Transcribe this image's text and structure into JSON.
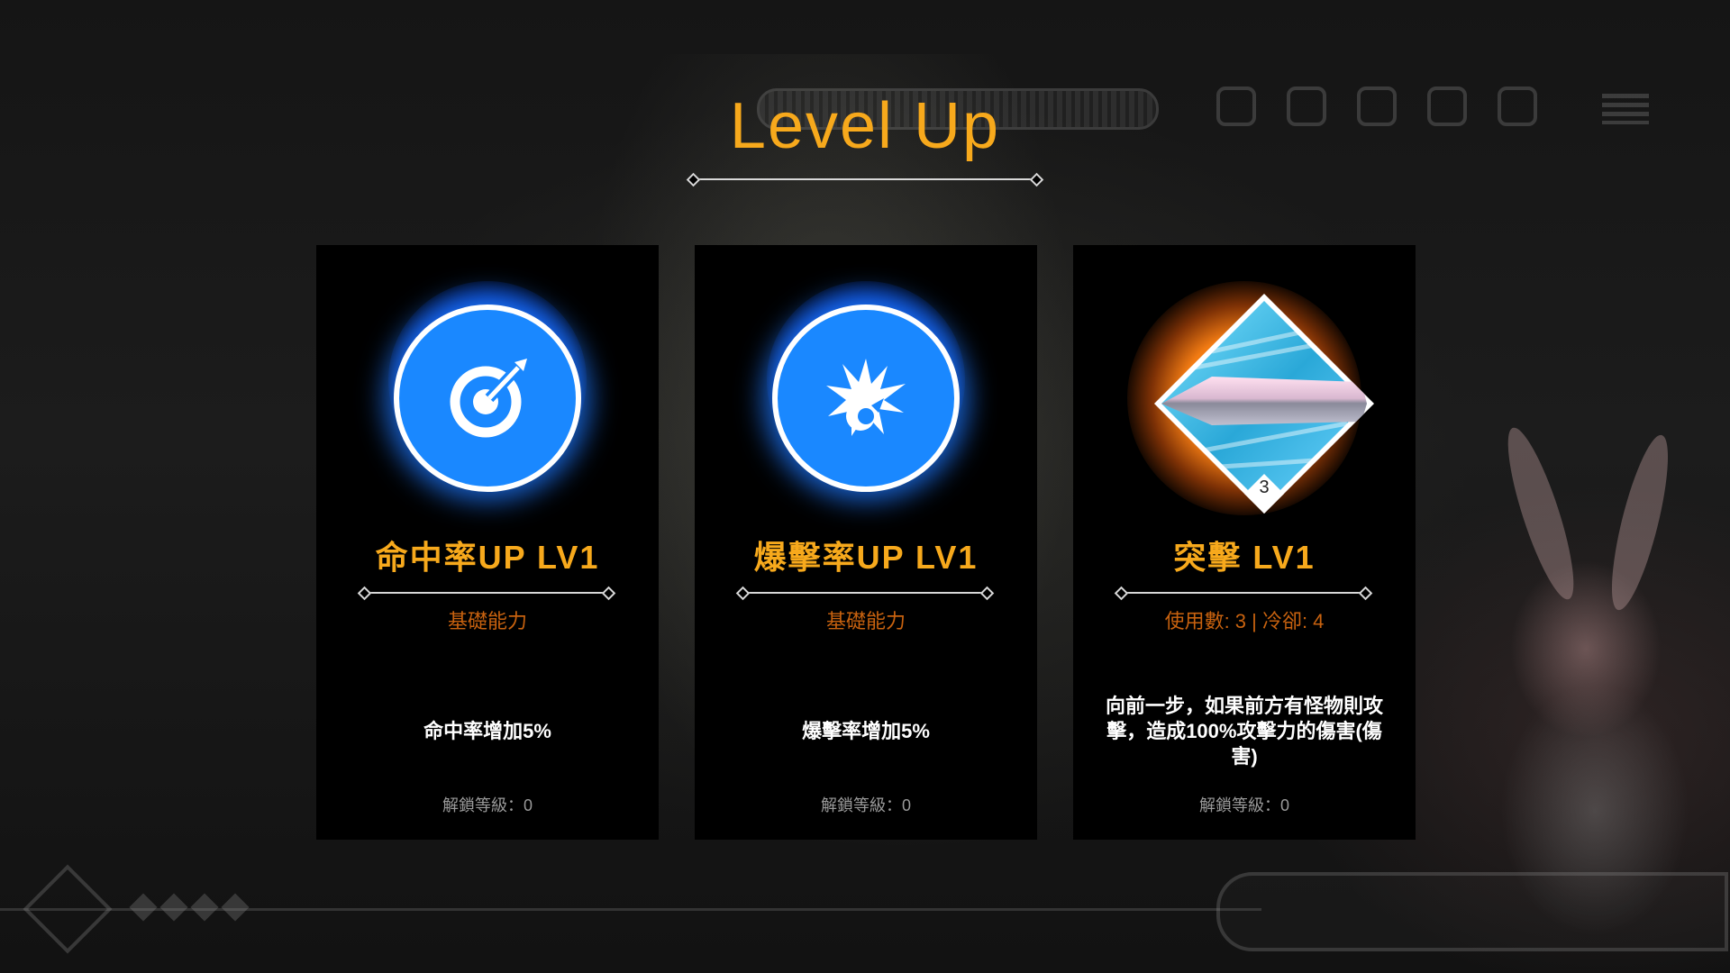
{
  "header": {
    "title": "Level Up"
  },
  "colors": {
    "title": "#f7a91c",
    "card_name": "#f7a91c",
    "card_sub": "#c8620f",
    "icon_blue": "#1a88ff",
    "icon_orange_glow": "#ff8214"
  },
  "cards": [
    {
      "icon": "target-icon",
      "name": "命中率UP LV1",
      "sub": "基礎能力",
      "desc": "命中率增加5%",
      "unlock": "解鎖等級：0"
    },
    {
      "icon": "explosion-icon",
      "name": "爆擊率UP LV1",
      "sub": "基礎能力",
      "desc": "爆擊率增加5%",
      "unlock": "解鎖等級：0"
    },
    {
      "icon": "sword-slash-icon",
      "badge": "3",
      "name": "突擊 LV1",
      "sub": "使用數: 3 | 冷卻: 4",
      "desc": "向前一步，如果前方有怪物則攻擊，造成100%攻擊力的傷害(傷害)",
      "unlock": "解鎖等級：0"
    }
  ]
}
